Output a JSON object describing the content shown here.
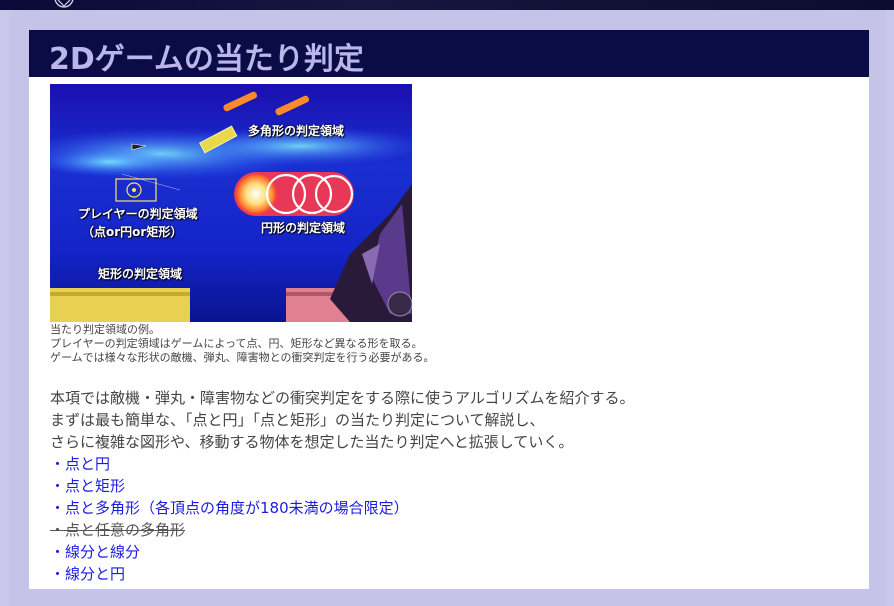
{
  "page": {
    "title": "2Dゲームの当たり判定"
  },
  "figure": {
    "labels": {
      "polygon": "多角形の判定領域",
      "player_line1": "プレイヤーの判定領域",
      "player_line2": "（点or円or矩形）",
      "circle": "円形の判定領域",
      "rect": "矩形の判定領域"
    },
    "caption_lines": [
      "当たり判定領域の例。",
      "プレイヤーの判定領域はゲームによって点、円、矩形など異なる形を取る。",
      "ゲームでは様々な形状の敵機、弾丸、障害物との衝突判定を行う必要がある。"
    ]
  },
  "intro_lines": [
    "本項では敵機・弾丸・障害物などの衝突判定をする際に使うアルゴリズムを紹介する。",
    "まずは最も簡単な、「点と円」「点と矩形」の当たり判定について解説し、",
    "さらに複雑な図形や、移動する物体を想定した当たり判定へと拡張していく。"
  ],
  "toc": [
    "・点と円",
    "・点と矩形",
    "・点と多角形（各頂点の角度が180未満の場合限定）",
    "・点と任意の多角形",
    "・線分と線分",
    "・線分と円"
  ],
  "colors": {
    "header_bg": "#0b0b46",
    "header_text": "#b9b7e9",
    "frame_bg": "#c5c4e8",
    "link": "#1c1ce0"
  }
}
